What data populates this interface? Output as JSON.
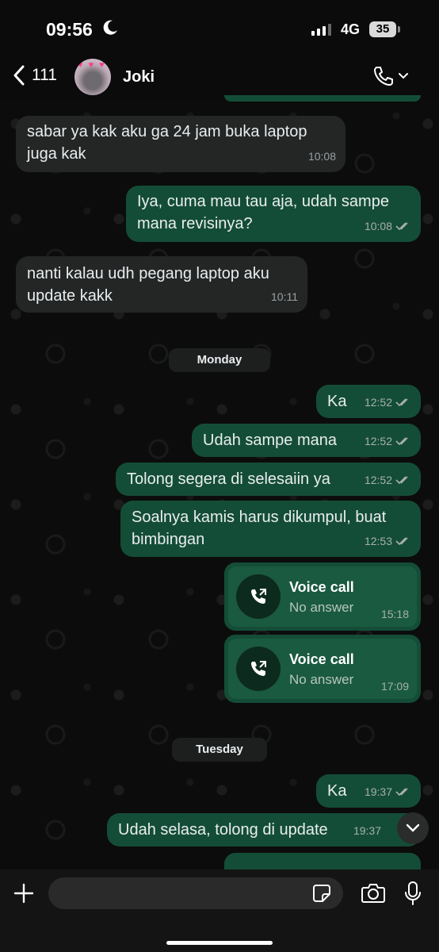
{
  "status_bar": {
    "time": "09:56",
    "network": "4G",
    "battery": "35"
  },
  "header": {
    "back_label": "111",
    "contact_name": "Joki"
  },
  "messages": [
    {
      "dir": "in",
      "text": "sabar ya kak aku ga 24 jam buka laptop juga kak",
      "time": "10:08"
    },
    {
      "dir": "out",
      "text": "Iya, cuma mau tau aja, udah sampe mana revisinya?",
      "time": "10:08"
    },
    {
      "dir": "in",
      "text": "nanti kalau udh pegang laptop aku update kakk",
      "time": "10:11"
    },
    {
      "dir": "out",
      "text": "Ka",
      "time": "12:52"
    },
    {
      "dir": "out",
      "text": "Udah sampe mana",
      "time": "12:52"
    },
    {
      "dir": "out",
      "text": "Tolong segera di selesaiin ya",
      "time": "12:52"
    },
    {
      "dir": "out",
      "text": "Soalnya kamis harus dikumpul, buat bimbingan",
      "time": "12:53"
    },
    {
      "dir": "out",
      "text": "Ka",
      "time": "19:37"
    },
    {
      "dir": "out",
      "text": "Udah selasa, tolong di update",
      "time": "19:37"
    }
  ],
  "dates": {
    "monday": "Monday",
    "tuesday": "Tuesday"
  },
  "calls": [
    {
      "title": "Voice call",
      "status": "No answer",
      "time": "15:18"
    },
    {
      "title": "Voice call",
      "status": "No answer",
      "time": "17:09"
    }
  ],
  "composer": {
    "placeholder": ""
  },
  "colors": {
    "outgoing_bubble": "#144d37",
    "incoming_bubble": "#242626",
    "background": "#0b0b0b"
  },
  "icons": [
    "moon-icon",
    "back-chevron-icon",
    "phone-icon",
    "chevron-down-icon",
    "call-outgoing-icon",
    "plus-icon",
    "sticker-icon",
    "camera-icon",
    "mic-icon"
  ]
}
